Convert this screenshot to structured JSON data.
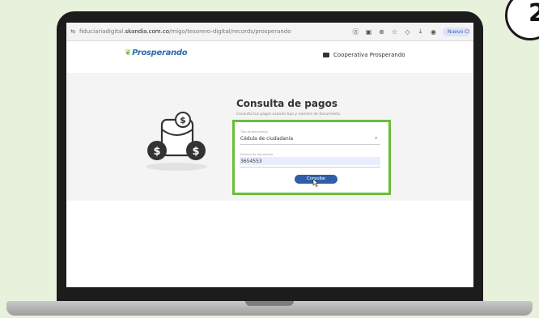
{
  "browser": {
    "url_prefix": "fiduciariadigital.",
    "url_host": "skandia.com.co",
    "url_path": "/migo/tesorero-digital/records/prosperando",
    "profile_label": "Nuevo Cl"
  },
  "site": {
    "logo_text": "Prosperando",
    "org_name": "Cooperativa Prosperando"
  },
  "page": {
    "title": "Consulta de pagos",
    "subtitle": "Consulta tus pagos usando tipo y número de documento."
  },
  "form": {
    "doc_type": {
      "label": "Tipo de documento",
      "value": "Cédula de ciudadanía"
    },
    "doc_number": {
      "label": "Número de documento",
      "value": "3654553"
    },
    "submit_label": "Consultar"
  },
  "badge": {
    "text": "2"
  },
  "colors": {
    "background": "#e8f1dc",
    "highlight_border": "#6cbd3b",
    "button": "#2f5ea6"
  },
  "icons": [
    "tune-icon",
    "translate-icon",
    "screenshot-icon",
    "zoom-icon",
    "star-icon",
    "extensions-icon",
    "download-icon",
    "account-icon",
    "money-wallet-icon",
    "cursor-icon"
  ]
}
